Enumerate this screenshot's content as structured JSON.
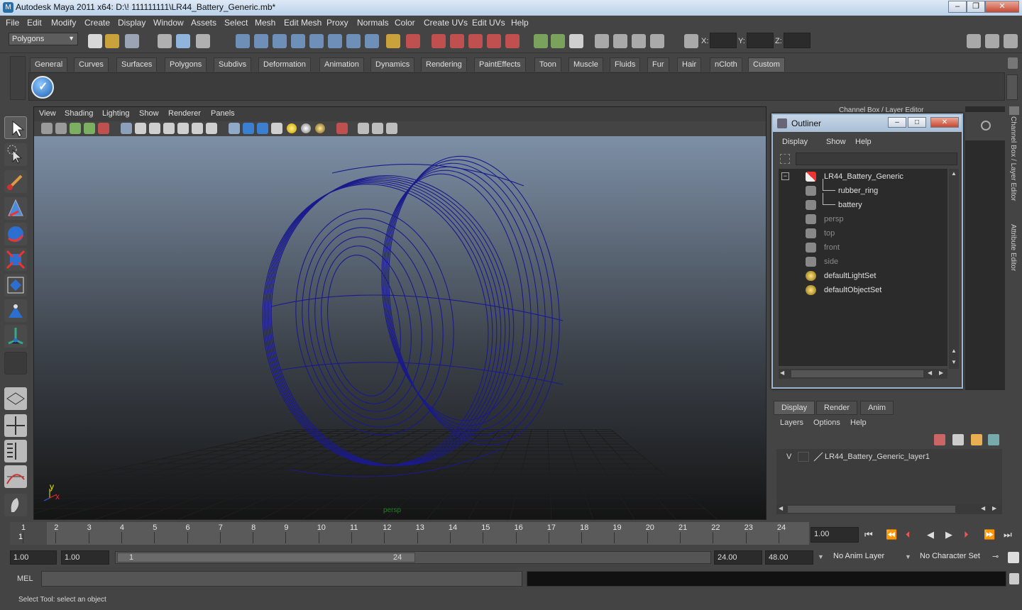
{
  "window": {
    "title": "Autodesk Maya 2011 x64: D:\\! 111111111\\LR44_Battery_Generic.mb*"
  },
  "menubar": [
    "File",
    "Edit",
    "Modify",
    "Create",
    "Display",
    "Window",
    "Assets",
    "Select",
    "Mesh",
    "Edit Mesh",
    "Proxy",
    "Normals",
    "Color",
    "Create UVs",
    "Edit UVs",
    "Help"
  ],
  "status": {
    "menu_set": "Polygons",
    "x_label": "X:",
    "y_label": "Y:",
    "z_label": "Z:"
  },
  "shelf": {
    "tabs": [
      "General",
      "Curves",
      "Surfaces",
      "Polygons",
      "Subdivs",
      "Deformation",
      "Animation",
      "Dynamics",
      "Rendering",
      "PaintEffects",
      "Toon",
      "Muscle",
      "Fluids",
      "Fur",
      "Hair",
      "nCloth",
      "Custom"
    ],
    "active_tab": "Custom"
  },
  "viewport": {
    "menu": [
      "View",
      "Shading",
      "Lighting",
      "Show",
      "Renderer",
      "Panels"
    ],
    "camera_label": "persp",
    "axis_y": "y",
    "axis_x": "x"
  },
  "panel_header": "Channel Box / Layer Editor",
  "outliner": {
    "title": "Outliner",
    "menu": [
      "Display",
      "Show",
      "Help"
    ],
    "items": [
      {
        "label": "LR44_Battery_Generic",
        "kind": "group",
        "dim": false
      },
      {
        "label": "rubber_ring",
        "kind": "mesh",
        "dim": false
      },
      {
        "label": "battery",
        "kind": "mesh",
        "dim": false
      },
      {
        "label": "persp",
        "kind": "camera",
        "dim": true
      },
      {
        "label": "top",
        "kind": "camera",
        "dim": true
      },
      {
        "label": "front",
        "kind": "camera",
        "dim": true
      },
      {
        "label": "side",
        "kind": "camera",
        "dim": true
      },
      {
        "label": "defaultLightSet",
        "kind": "set",
        "dim": false
      },
      {
        "label": "defaultObjectSet",
        "kind": "set",
        "dim": false
      }
    ]
  },
  "side_tabs": {
    "channel_box": "Channel Box / Layer Editor",
    "attribute_editor": "Attribute Editor"
  },
  "layer_editor": {
    "tabs": [
      "Display",
      "Render",
      "Anim"
    ],
    "menu": [
      "Layers",
      "Options",
      "Help"
    ],
    "layer": {
      "visibility": "V",
      "name": "LR44_Battery_Generic_layer1"
    }
  },
  "timeline": {
    "ticks": [
      "1",
      "2",
      "3",
      "4",
      "5",
      "6",
      "7",
      "8",
      "9",
      "10",
      "11",
      "12",
      "13",
      "14",
      "15",
      "16",
      "17",
      "18",
      "19",
      "20",
      "21",
      "22",
      "23",
      "24"
    ],
    "current_frame": "1",
    "current_time": "1.00"
  },
  "range": {
    "start": "1.00",
    "playback_start": "1.00",
    "slider_start": "1",
    "slider_end": "24",
    "playback_end": "24.00",
    "end": "48.00",
    "anim_layer": "No Anim Layer",
    "character_set": "No Character Set"
  },
  "command": {
    "label": "MEL"
  },
  "help_line": "Select Tool: select an object",
  "colors": {
    "wireframe": "#1a1a8c",
    "viewport_top": "#7d8fa6",
    "viewport_bottom": "#141414"
  }
}
